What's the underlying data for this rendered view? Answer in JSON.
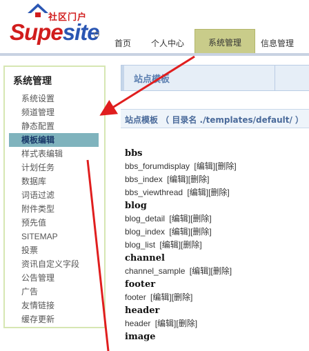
{
  "brand": {
    "cn": "社区门户",
    "word_a": "Supe",
    "word_b": "site"
  },
  "nav": {
    "items": [
      {
        "label": "首页",
        "key": "home"
      },
      {
        "label": "个人中心",
        "key": "personal"
      },
      {
        "label": "系统管理",
        "key": "system",
        "active": true
      },
      {
        "label": "信息管理",
        "key": "info"
      }
    ]
  },
  "sidebar": {
    "title": "系统管理",
    "items": [
      "系统设置",
      "频道管理",
      "静态配置",
      "模板编辑",
      "样式表编辑",
      "计划任务",
      "数据库",
      "词语过滤",
      "附件类型",
      "预先值",
      "SITEMAP",
      "投票",
      "资讯自定义字段",
      "公告管理",
      "广告",
      "友情链接",
      "缓存更新"
    ],
    "active_index": 3
  },
  "main": {
    "header_title": "站点模板",
    "subheader": "站点模板 （ 目录名 ./templates/default/ ）",
    "edit_label": "[编辑]",
    "delete_label": "[删除]",
    "groups": [
      {
        "name": "bbs",
        "files": [
          "bbs_forumdisplay",
          "bbs_index",
          "bbs_viewthread"
        ]
      },
      {
        "name": "blog",
        "files": [
          "blog_detail",
          "blog_index",
          "blog_list"
        ]
      },
      {
        "name": "channel",
        "files": [
          "channel_sample"
        ]
      },
      {
        "name": "footer",
        "files": [
          "footer"
        ]
      },
      {
        "name": "header",
        "files": [
          "header"
        ]
      },
      {
        "name": "image",
        "files": []
      }
    ]
  },
  "colors": {
    "annotation_arrow": "#e01e1e",
    "active_menu_bg": "#7fb3bd",
    "active_nav_bg": "#c9cc8a"
  }
}
